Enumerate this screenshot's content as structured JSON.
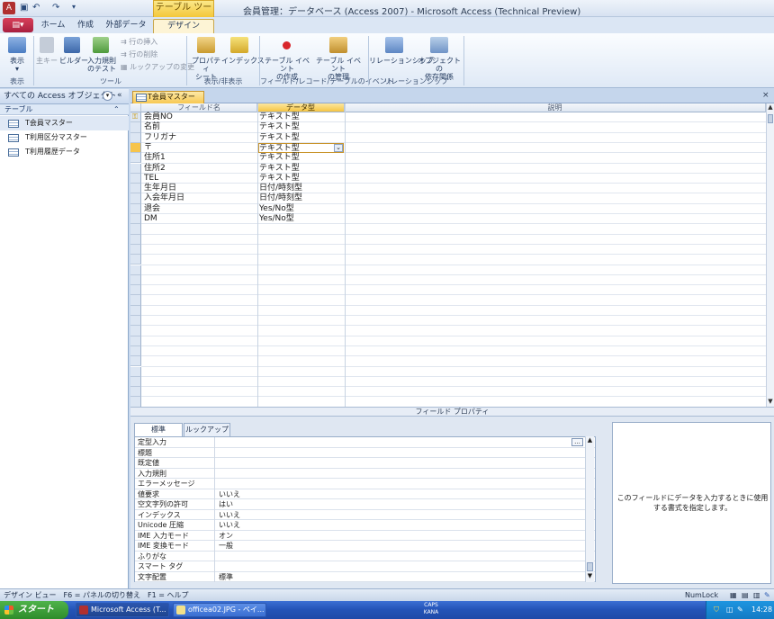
{
  "window": {
    "title": "会員管理：データベース (Access 2007) - Microsoft Access (Technical Preview)",
    "context_group": "テーブル ツール"
  },
  "quick_access": {
    "save_icon": "save-icon",
    "undo_icon": "undo-icon",
    "redo_icon": "redo-icon"
  },
  "ribbon": {
    "tabs": [
      "ホーム",
      "作成",
      "外部データ",
      "デザイン"
    ],
    "groups": {
      "view": {
        "label": "表示",
        "buttons": [
          "表示"
        ]
      },
      "tools": {
        "label": "ツール",
        "buttons": [
          "主キー",
          "ビルダー",
          "入力規則\nのテスト"
        ],
        "small_items": [
          "行の挿入",
          "行の削除",
          "ルックアップの変更"
        ]
      },
      "show_hide": {
        "label": "表示/非表示",
        "buttons": [
          "プロパティ\nシート",
          "インデックス"
        ]
      },
      "events": {
        "label": "フィールド/レコード/テーブルのイベント",
        "buttons": [
          "テーブル イベント\nの作成",
          "テーブル イベント\nの管理"
        ]
      },
      "relations": {
        "label": "リレーションシップ",
        "buttons": [
          "リレーションシップ",
          "オブジェクトの\n依存関係"
        ]
      }
    }
  },
  "nav_pane": {
    "header": "すべての Access オブジェクト",
    "section": "テーブル",
    "items": [
      "T会員マスター",
      "T利用区分マスター",
      "T利用履歴データ"
    ],
    "selected_index": 0
  },
  "document": {
    "tab": "T会員マスター",
    "columns": [
      "フィールド名",
      "データ型",
      "説明"
    ],
    "fields": [
      {
        "name": "会員NO",
        "type": "テキスト型",
        "key": true
      },
      {
        "name": "名前",
        "type": "テキスト型"
      },
      {
        "name": "フリガナ",
        "type": "テキスト型"
      },
      {
        "name": "〒",
        "type": "テキスト型",
        "current": true
      },
      {
        "name": "住所1",
        "type": "テキスト型"
      },
      {
        "name": "住所2",
        "type": "テキスト型"
      },
      {
        "name": "TEL",
        "type": "テキスト型"
      },
      {
        "name": "生年月日",
        "type": "日付/時刻型"
      },
      {
        "name": "入会年月日",
        "type": "日付/時刻型"
      },
      {
        "name": "退会",
        "type": "Yes/No型"
      },
      {
        "name": "DM",
        "type": "Yes/No型"
      }
    ]
  },
  "field_properties": {
    "title": "フィールド プロパティ",
    "tabs": [
      "標準",
      "ルックアップ"
    ],
    "rows": [
      {
        "name": "定型入力",
        "value": ""
      },
      {
        "name": "標題",
        "value": ""
      },
      {
        "name": "既定値",
        "value": ""
      },
      {
        "name": "入力規則",
        "value": ""
      },
      {
        "name": "エラーメッセージ",
        "value": ""
      },
      {
        "name": "値要求",
        "value": "いいえ"
      },
      {
        "name": "空文字列の許可",
        "value": "はい"
      },
      {
        "name": "インデックス",
        "value": "いいえ"
      },
      {
        "name": "Unicode 圧縮",
        "value": "いいえ"
      },
      {
        "name": "IME 入力モード",
        "value": "オン"
      },
      {
        "name": "IME 変換モード",
        "value": "一般"
      },
      {
        "name": "ふりがな",
        "value": ""
      },
      {
        "name": "スマート タグ",
        "value": ""
      },
      {
        "name": "文字配置",
        "value": "標準"
      }
    ],
    "help_text": "このフィールドにデータを入力するときに使用する書式を指定します。"
  },
  "statusbar": {
    "left": "デザイン ビュー　F6 = パネルの切り替え　F1 = ヘルプ",
    "numlock": "NumLock"
  },
  "taskbar": {
    "start": "スタート",
    "items": [
      "Microsoft Access (T...",
      "officea02.JPG - ペイ..."
    ],
    "caps": "CAPS\nKANA",
    "clock": "14:28"
  }
}
